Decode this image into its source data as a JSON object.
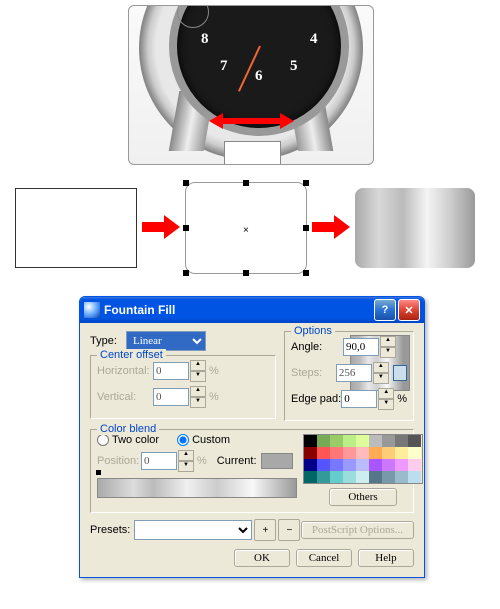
{
  "dialog": {
    "title": "Fountain Fill",
    "type_label": "Type:",
    "type_value": "Linear",
    "center_offset": {
      "legend": "Center offset",
      "horizontal_label": "Horizontal:",
      "horizontal_value": "0",
      "vertical_label": "Vertical:",
      "vertical_value": "0",
      "percent": "%"
    },
    "options": {
      "legend": "Options",
      "angle_label": "Angle:",
      "angle_value": "90,0",
      "steps_label": "Steps:",
      "steps_value": "256",
      "edgepad_label": "Edge pad:",
      "edgepad_value": "0",
      "percent": "%"
    },
    "color_blend": {
      "legend": "Color blend",
      "two_color_label": "Two color",
      "custom_label": "Custom",
      "position_label": "Position:",
      "position_value": "0",
      "percent": "%",
      "current_label": "Current:",
      "others_label": "Others"
    },
    "presets": {
      "label": "Presets:",
      "value": ""
    },
    "postscript_label": "PostScript Options...",
    "buttons": {
      "ok": "OK",
      "cancel": "Cancel",
      "help": "Help"
    }
  },
  "watch_numbers": [
    "4",
    "5",
    "6",
    "7",
    "8"
  ],
  "swatch_colors": [
    "#000",
    "#7a5",
    "#9c6",
    "#be8",
    "#df9",
    "#bbb",
    "#999",
    "#777",
    "#555",
    "#800",
    "#f55",
    "#f77",
    "#f99",
    "#fbb",
    "#fa5",
    "#fc7",
    "#fe9",
    "#ffc",
    "#008",
    "#55f",
    "#77f",
    "#99f",
    "#bbf",
    "#a5f",
    "#c7f",
    "#e9f",
    "#fce",
    "#066",
    "#399",
    "#6cc",
    "#9dd",
    "#cee",
    "#578",
    "#79a",
    "#9bc",
    "#bde"
  ]
}
